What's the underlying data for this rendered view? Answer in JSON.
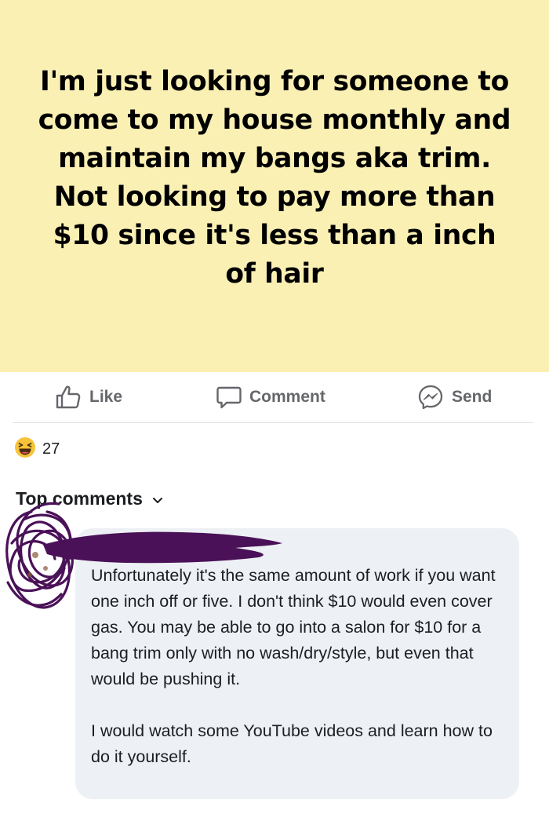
{
  "post": {
    "text": "I'm just looking for someone to come to my house monthly and maintain my bangs aka trim. Not looking to pay more than $10 since it's less than a inch of hair",
    "background_color": "#fbf0b4"
  },
  "actions": {
    "like_label": "Like",
    "like_icon": "thumbs-up-icon",
    "comment_label": "Comment",
    "comment_icon": "speech-bubble-icon",
    "send_label": "Send",
    "send_icon": "messenger-icon"
  },
  "reactions": {
    "icon": "laughing-emoji-icon",
    "count": "27"
  },
  "comments_header": {
    "label": "Top comments",
    "icon": "chevron-down-icon"
  },
  "comment": {
    "author": "[redacted]",
    "paragraphs": [
      "Unfortunately it's the same amount of work if you want one inch off or five. I don't think $10 would even cover gas. You may be able to go into a salon for $10 for a bang trim only with no wash/dry/style, but even that would be pushing it.",
      "I would watch some YouTube videos and learn how to do it yourself."
    ]
  },
  "colors": {
    "redaction_scribble": "#4a1158",
    "bubble": "#edf0f4",
    "secondary_text": "#65676b"
  }
}
